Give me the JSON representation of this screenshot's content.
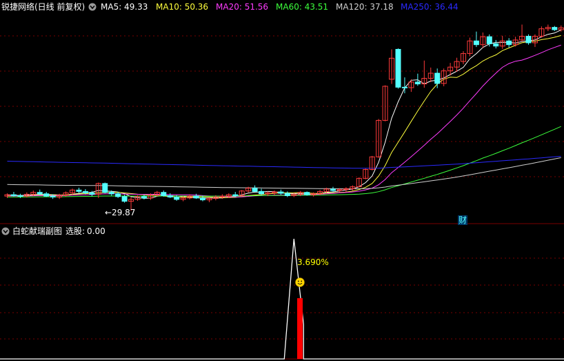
{
  "colors": {
    "background": "#000000",
    "grid": "#7a0000",
    "up": "#ff3b3b",
    "down": "#54ffff",
    "ma5": "#ffffff",
    "ma10": "#ffff3c",
    "ma20": "#ff3cff",
    "ma60": "#3cff3c",
    "ma120": "#d0d0d0",
    "ma250": "#2a2aff",
    "signal_line": "#ffffff",
    "signal_bar": "#ff0000",
    "pct_text": "#ffff00",
    "cai_text": "#54ffff",
    "low_text": "#ffffff"
  },
  "main_panel": {
    "title": "锐捷网络(日线 前复权)",
    "collapse_icon": "circle-chevron-down-icon",
    "ma_items": [
      {
        "label": "MA5",
        "value": "49.33",
        "color": "#ffffff"
      },
      {
        "label": "MA10",
        "value": "50.36",
        "color": "#ffff3c"
      },
      {
        "label": "MA20",
        "value": "51.56",
        "color": "#ff3cff"
      },
      {
        "label": "MA60",
        "value": "43.51",
        "color": "#3cff3c"
      },
      {
        "label": "MA120",
        "value": "37.18",
        "color": "#d0d0d0"
      },
      {
        "label": "MA250",
        "value": "36.44",
        "color": "#2a2aff"
      }
    ],
    "low_label": "←29.87",
    "cai_marker": "财"
  },
  "sub_panel": {
    "title": "白蛇献瑞副图",
    "signal_label": "选股:",
    "signal_value": "0.00",
    "collapse_icon": "circle-chevron-down-icon",
    "pct_label": "3.690%",
    "smiley_icon": "smiley-face-icon"
  },
  "chart_data": [
    {
      "type": "candlestick",
      "title": "锐捷网络(日线 前复权)",
      "indicators": {
        "MA5": 49.33,
        "MA10": 50.36,
        "MA20": 51.56,
        "MA60": 43.51,
        "MA120": 37.18,
        "MA250": 36.44
      },
      "annotations": [
        "←29.87",
        "财"
      ],
      "ohlc": [
        [
          33.0,
          33.6,
          32.6,
          33.3
        ],
        [
          33.3,
          33.9,
          32.9,
          33.1
        ],
        [
          33.1,
          33.5,
          32.6,
          33.0
        ],
        [
          33.0,
          33.8,
          32.7,
          33.4
        ],
        [
          33.4,
          34.2,
          33.0,
          33.8
        ],
        [
          33.8,
          34.4,
          33.2,
          33.5
        ],
        [
          33.5,
          33.9,
          32.8,
          33.0
        ],
        [
          33.0,
          33.4,
          32.4,
          32.8
        ],
        [
          32.8,
          33.5,
          32.4,
          33.2
        ],
        [
          33.2,
          34.0,
          32.9,
          33.7
        ],
        [
          33.7,
          34.6,
          33.3,
          34.3
        ],
        [
          34.3,
          34.8,
          33.6,
          34.0
        ],
        [
          34.0,
          34.5,
          33.4,
          33.7
        ],
        [
          33.7,
          34.1,
          33.0,
          33.4
        ],
        [
          33.4,
          35.9,
          32.6,
          35.7
        ],
        [
          35.7,
          35.9,
          33.6,
          33.8
        ],
        [
          33.8,
          34.2,
          33.1,
          33.5
        ],
        [
          33.5,
          33.9,
          32.6,
          32.9
        ],
        [
          32.9,
          33.3,
          31.6,
          31.9
        ],
        [
          31.9,
          32.8,
          29.87,
          32.3
        ],
        [
          32.3,
          33.2,
          32.0,
          32.9
        ],
        [
          32.9,
          33.3,
          32.3,
          32.6
        ],
        [
          32.6,
          33.6,
          32.2,
          33.2
        ],
        [
          33.2,
          34.1,
          32.9,
          33.8
        ],
        [
          33.8,
          34.2,
          32.9,
          33.1
        ],
        [
          33.1,
          33.6,
          32.6,
          32.8
        ],
        [
          32.8,
          33.2,
          32.0,
          32.3
        ],
        [
          32.3,
          33.0,
          31.9,
          32.6
        ],
        [
          32.6,
          33.4,
          32.3,
          33.0
        ],
        [
          33.0,
          33.5,
          32.4,
          32.6
        ],
        [
          32.6,
          33.1,
          31.9,
          32.2
        ],
        [
          32.2,
          32.7,
          31.7,
          32.5
        ],
        [
          32.5,
          33.2,
          32.1,
          32.8
        ],
        [
          32.8,
          33.4,
          32.4,
          33.0
        ],
        [
          33.0,
          33.6,
          32.6,
          33.3
        ],
        [
          33.3,
          33.9,
          32.8,
          33.1
        ],
        [
          33.1,
          34.3,
          32.9,
          34.1
        ],
        [
          34.1,
          35.0,
          33.8,
          34.7
        ],
        [
          34.7,
          35.3,
          33.9,
          34.0
        ],
        [
          34.0,
          34.6,
          33.2,
          33.5
        ],
        [
          33.5,
          34.0,
          33.0,
          33.7
        ],
        [
          33.7,
          34.2,
          33.2,
          33.9
        ],
        [
          33.9,
          34.4,
          33.3,
          33.6
        ],
        [
          33.6,
          34.0,
          32.8,
          33.1
        ],
        [
          33.1,
          33.7,
          32.8,
          33.4
        ],
        [
          33.4,
          34.1,
          33.0,
          33.8
        ],
        [
          33.8,
          34.0,
          33.1,
          33.3
        ],
        [
          33.3,
          33.8,
          32.9,
          33.5
        ],
        [
          33.5,
          34.3,
          33.2,
          34.0
        ],
        [
          34.0,
          34.8,
          33.7,
          34.5
        ],
        [
          34.5,
          35.0,
          33.9,
          34.2
        ],
        [
          34.2,
          34.7,
          33.8,
          34.4
        ],
        [
          34.4,
          34.9,
          33.9,
          34.6
        ],
        [
          34.6,
          35.3,
          34.2,
          35.0
        ],
        [
          35.0,
          37.0,
          34.9,
          36.8
        ],
        [
          36.8,
          38.9,
          36.6,
          38.7
        ],
        [
          38.7,
          41.6,
          38.5,
          41.4
        ],
        [
          41.4,
          49.5,
          41.2,
          49.2
        ],
        [
          49.2,
          56.7,
          49.0,
          56.5
        ],
        [
          58.0,
          64.4,
          57.0,
          62.5
        ],
        [
          64.4,
          64.6,
          56.0,
          56.3
        ],
        [
          56.3,
          58.4,
          55.0,
          56.2
        ],
        [
          56.2,
          58.0,
          55.3,
          57.4
        ],
        [
          57.4,
          59.2,
          56.6,
          57.0
        ],
        [
          57.0,
          62.0,
          56.2,
          58.2
        ],
        [
          58.2,
          60.5,
          57.4,
          59.3
        ],
        [
          59.3,
          60.3,
          56.1,
          57.1
        ],
        [
          57.1,
          60.3,
          56.5,
          59.8
        ],
        [
          59.8,
          61.5,
          58.8,
          60.6
        ],
        [
          60.6,
          62.6,
          59.6,
          61.8
        ],
        [
          61.8,
          64.0,
          61.2,
          63.5
        ],
        [
          63.5,
          66.9,
          62.9,
          66.2
        ],
        [
          66.2,
          68.2,
          64.9,
          65.4
        ],
        [
          65.4,
          68.0,
          64.7,
          67.1
        ],
        [
          67.1,
          67.6,
          65.0,
          65.6
        ],
        [
          65.6,
          66.4,
          64.6,
          65.1
        ],
        [
          65.1,
          67.3,
          64.5,
          66.2
        ],
        [
          66.2,
          66.8,
          64.8,
          65.4
        ],
        [
          65.4,
          67.1,
          65.0,
          66.4
        ],
        [
          66.4,
          69.7,
          66.0,
          67.2
        ],
        [
          67.2,
          67.6,
          65.4,
          65.8
        ],
        [
          65.8,
          67.6,
          64.9,
          67.2
        ],
        [
          67.2,
          69.3,
          66.9,
          68.8
        ],
        [
          68.8,
          69.7,
          68.3,
          69.1
        ],
        [
          69.1,
          69.4,
          68.3,
          68.6
        ],
        [
          68.6,
          69.5,
          68.2,
          69.0
        ]
      ]
    },
    {
      "type": "line",
      "title": "白蛇献瑞副图",
      "series": [
        {
          "name": "选股",
          "values": [
            0.0
          ]
        }
      ],
      "annotations": [
        "3.690%"
      ]
    }
  ]
}
